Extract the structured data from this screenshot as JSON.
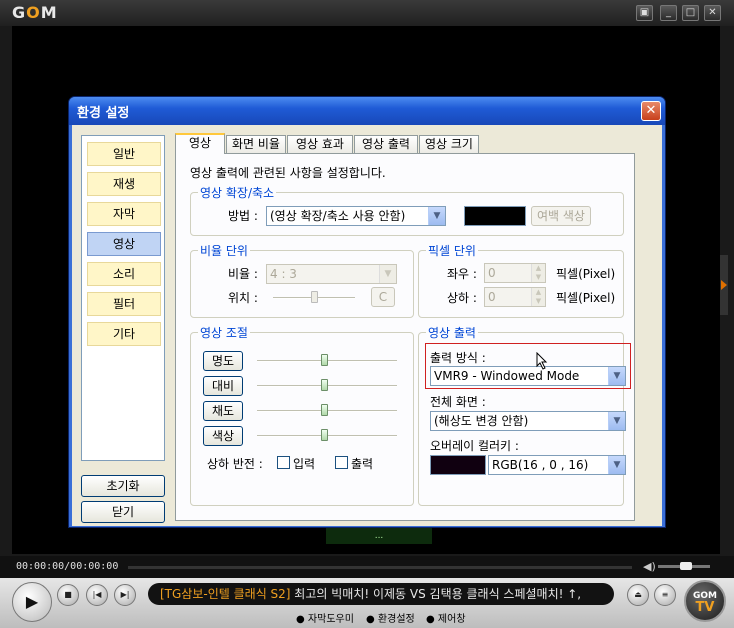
{
  "player": {
    "logo_g": "G",
    "logo_o": "O",
    "logo_m": "M",
    "window_buttons": [
      "▣",
      "_",
      "□",
      "✕"
    ],
    "subtitle_hint": "...",
    "time": "00:00:00/00:00:00",
    "ticker_tag": "[TG삼보-인텔 클래식 S2]",
    "ticker_text": " 최고의 빅매치! 이제동 VS 김택용 클래식 스페셜매치! ↑,",
    "links": [
      "자막도우미",
      "환경설정",
      "제어창"
    ],
    "gomtv_top": "GOM",
    "gomtv_bottom": "TV"
  },
  "dialog": {
    "title": "환경 설정",
    "close": "✕",
    "nav": [
      "일반",
      "재생",
      "자막",
      "영상",
      "소리",
      "필터",
      "기타"
    ],
    "active_nav": "영상",
    "reset_button": "초기화",
    "close_button": "닫기",
    "tabs": [
      "영상",
      "화면 비율",
      "영상 효과",
      "영상 출력",
      "영상 크기"
    ],
    "active_tab": "영상",
    "description": "영상 출력에 관련된 사항을 설정합니다.",
    "scale_group": {
      "title": "영상 확장/축소",
      "method_label": "방법 :",
      "method_value": "(영상 확장/축소 사용 안함)",
      "margin_color_button": "여백 색상",
      "margin_color": "#000000"
    },
    "ratio_group": {
      "title": "비율 단위",
      "ratio_label": "비율 :",
      "ratio_value": "4 : 3",
      "position_label": "위치 :",
      "c_button": "C"
    },
    "pixel_group": {
      "title": "픽셀 단위",
      "lr_label": "좌우 :",
      "lr_value": "0",
      "lr_unit": "픽셀(Pixel)",
      "ud_label": "상하 :",
      "ud_value": "0",
      "ud_unit": "픽셀(Pixel)"
    },
    "adjust_group": {
      "title": "영상 조절",
      "buttons": [
        "명도",
        "대비",
        "채도",
        "색상"
      ],
      "flip_label": "상하 반전 :",
      "flip_input": "입력",
      "flip_output": "출력"
    },
    "output_group": {
      "title": "영상 출력",
      "method_label": "출력 방식 :",
      "method_value": "VMR9 - Windowed Mode",
      "fullscreen_label": "전체 화면 :",
      "fullscreen_value": "(해상도 변경 안함)",
      "overlay_label": "오버레이 컬러키 :",
      "overlay_value": "RGB(16 , 0 , 16)",
      "overlay_color": "#100010"
    }
  }
}
